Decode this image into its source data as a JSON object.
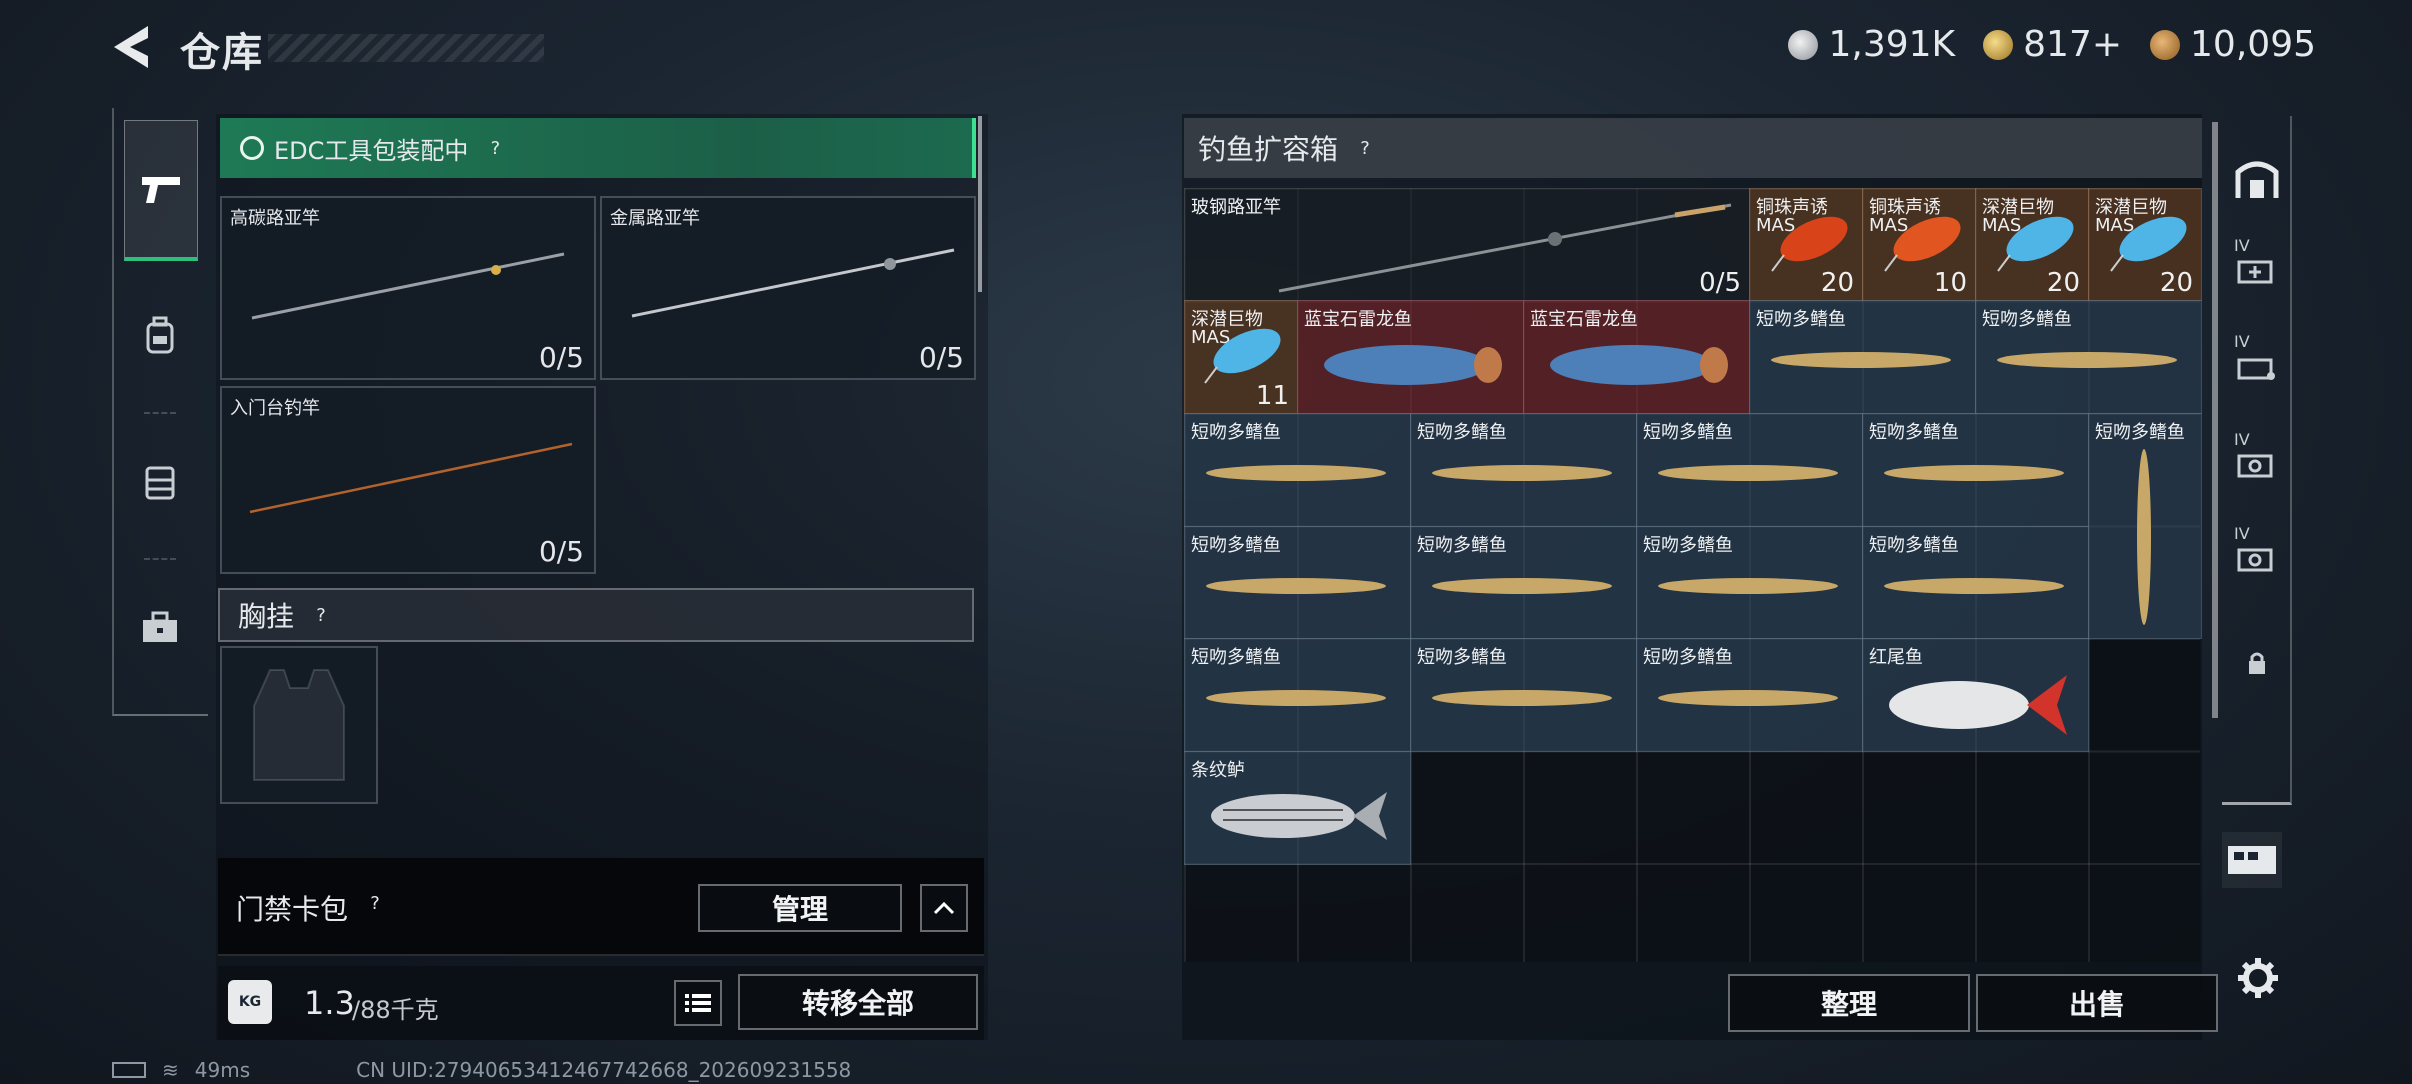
{
  "header": {
    "title": "仓库"
  },
  "currencies": [
    {
      "icon": "silver-coin-icon",
      "value": "1,391K"
    },
    {
      "icon": "gold-coin-icon",
      "value": "817+"
    },
    {
      "icon": "bronze-coin-icon",
      "value": "10,095"
    }
  ],
  "left": {
    "edc_label": "EDC工具包装配中",
    "slots": [
      {
        "label": "高碳路亚竿",
        "count": "0/5"
      },
      {
        "label": "金属路亚竿",
        "count": "0/5"
      },
      {
        "label": "入门台钓竿",
        "count": "0/5"
      }
    ],
    "chest_section": "胸挂",
    "keycard_label": "门禁卡包",
    "manage_button": "管理",
    "weight_value": "1.3",
    "weight_max": "/88千克",
    "transfer_all_button": "转移全部"
  },
  "right": {
    "title": "钓鱼扩容箱",
    "items": [
      {
        "label": "玻钢路亚竿",
        "count": "0/5"
      },
      {
        "label": "铜珠声诱",
        "sub": "MAS",
        "count": "20"
      },
      {
        "label": "铜珠声诱",
        "sub": "MAS",
        "count": "10"
      },
      {
        "label": "深潜巨物",
        "sub": "MAS",
        "count": "20"
      },
      {
        "label": "深潜巨物",
        "sub": "MAS",
        "count": "20"
      },
      {
        "label": "深潜巨物",
        "sub": "MAS",
        "count": "11"
      },
      {
        "label": "蓝宝石雷龙鱼"
      },
      {
        "label": "蓝宝石雷龙鱼"
      },
      {
        "label": "短吻多鳍鱼"
      },
      {
        "label": "短吻多鳍鱼"
      },
      {
        "label": "短吻多鳍鱼"
      },
      {
        "label": "短吻多鳍鱼"
      },
      {
        "label": "短吻多鳍鱼"
      },
      {
        "label": "短吻多鳍鱼"
      },
      {
        "label": "短吻多鳍鱼"
      },
      {
        "label": "短吻多鳍鱼"
      },
      {
        "label": "短吻多鳍鱼"
      },
      {
        "label": "短吻多鳍鱼"
      },
      {
        "label": "短吻多鳍鱼"
      },
      {
        "label": "短吻多鳍鱼"
      },
      {
        "label": "短吻多鳍鱼"
      },
      {
        "label": "短吻多鳍鱼"
      },
      {
        "label": "短吻多鳍鱼"
      },
      {
        "label": "红尾鱼"
      },
      {
        "label": "条纹鲈"
      }
    ],
    "sort_button": "整理",
    "sell_button": "出售"
  },
  "right_tabs": {
    "iv_label": "IV"
  },
  "status": {
    "ping": "49ms",
    "uid": "CN UID:27940653412467742668_202609231558"
  },
  "colors": {
    "accent_green": "#2fbf7c",
    "edc_bar": "#1e7a55"
  }
}
